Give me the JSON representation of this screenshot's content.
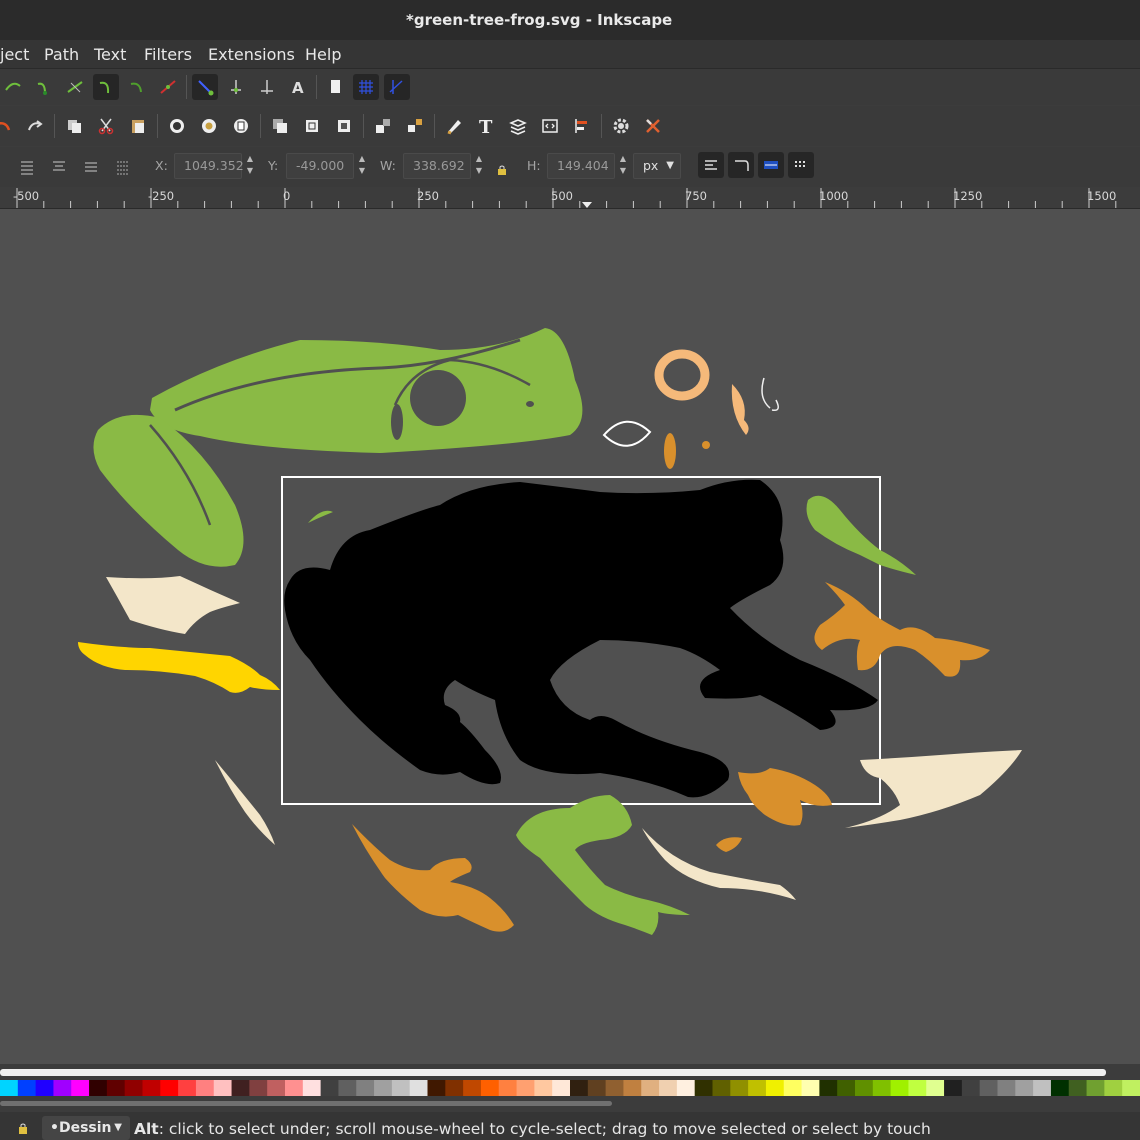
{
  "window": {
    "title": "*green-tree-frog.svg - Inkscape"
  },
  "menu": {
    "items": [
      "ject",
      "Path",
      "Text",
      "Filters",
      "Extensions",
      "Help"
    ]
  },
  "toolbar_nodes": {
    "icons": [
      "node-add-icon",
      "node-join-icon",
      "node-break-icon",
      "node-cusp-icon",
      "node-smooth-icon",
      "node-delete-icon",
      "snap-nodes-icon",
      "snap-align-icon",
      "snap-midpoint-icon",
      "snap-text-icon",
      "page-icon",
      "grid-icon",
      "guide-icon"
    ]
  },
  "toolbar_commands": {
    "icons": [
      "undo-icon",
      "redo-icon",
      "copy-icon",
      "cut-icon",
      "paste-icon",
      "zoom-selection-icon",
      "zoom-drawing-icon",
      "zoom-page-icon",
      "duplicate-icon",
      "clone-icon",
      "unlink-clone-icon",
      "group-icon",
      "ungroup-icon",
      "fill-stroke-icon",
      "text-font-icon",
      "layers-icon",
      "xml-editor-icon",
      "align-distribute-icon",
      "preferences-icon",
      "document-properties-icon"
    ]
  },
  "transform": {
    "x_label": "X:",
    "x_value": "1049.352",
    "y_label": "Y:",
    "y_value": "-49.000",
    "w_label": "W:",
    "w_value": "338.692",
    "h_label": "H:",
    "h_value": "149.404",
    "unit": "px"
  },
  "ruler": {
    "labels": [
      "-500",
      "-250",
      "0",
      "250",
      "500",
      "750",
      "1000",
      "1250",
      "1500"
    ]
  },
  "palette": {
    "colors": [
      "#00d4ff",
      "#0040ff",
      "#2000ff",
      "#a000ff",
      "#ff00ff",
      "#300000",
      "#600000",
      "#900000",
      "#c00000",
      "#ff0000",
      "#ff4040",
      "#ff8080",
      "#ffc0c0",
      "#402020",
      "#804040",
      "#c06060",
      "#ff9090",
      "#ffe0e0",
      "#404040",
      "#606060",
      "#808080",
      "#a0a0a0",
      "#c0c0c0",
      "#e0e0e0",
      "#401800",
      "#803000",
      "#c04800",
      "#ff6000",
      "#ff8040",
      "#ffa070",
      "#ffc8a0",
      "#ffe8d8",
      "#302010",
      "#604020",
      "#906030",
      "#c08040",
      "#e0b080",
      "#f0d0b0",
      "#fff0e0",
      "#303000",
      "#606000",
      "#909000",
      "#c0c000",
      "#f0f000",
      "#ffff60",
      "#ffffb0",
      "#203000",
      "#406000",
      "#609000",
      "#80c000",
      "#a0f000",
      "#c0ff40",
      "#e0ff90",
      "#202020",
      "#404040",
      "#606060",
      "#808080",
      "#a0a0a0",
      "#c0c0c0",
      "#003000",
      "#406020",
      "#70a030",
      "#a0d040",
      "#c0f060"
    ]
  },
  "status": {
    "layer": "•Dessin",
    "key": "Alt",
    "message": ": click to select under; scroll mouse-wheel to cycle-select; drag to move selected or select by touch"
  }
}
